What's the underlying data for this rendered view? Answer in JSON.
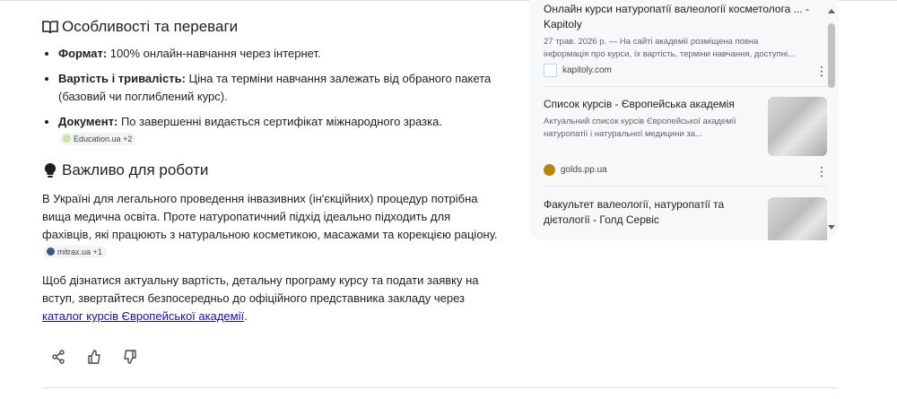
{
  "main": {
    "section1_title": "Особливості та переваги",
    "features": [
      {
        "label": "Формат:",
        "text": " 100% онлайн-навчання через інтернет."
      },
      {
        "label": "Вартість і тривалість:",
        "text": " Ціна та терміни навчання залежать від обраного пакета (базовий чи поглиблений курс)."
      },
      {
        "label": "Документ:",
        "text": " По завершенні видається сертифікат міжнародного зразка."
      }
    ],
    "chip1": {
      "label": "Education.ua",
      "count": "+2"
    },
    "section2_title": "Важливо для роботи",
    "para1": "В Україні для легального проведення інвазивних (ін'єкційних) процедур потрібна вища медична освіта. Проте натуропатичний підхід ідеально підходить для фахівців, які працюють з натуральною косметикою, масажами та корекцією раціону.",
    "chip2": {
      "label": "mitrax.ua",
      "count": "+1"
    },
    "para2": "Щоб дізнатися актуальну вартість, детальну програму курсу та подати заявку на вступ, звертайтеся безпосередньо до офіційного представника закладу через ",
    "para2_link": "каталог курсів Європейської академії",
    "para2_end": "."
  },
  "sources": [
    {
      "title": "Онлайн курси натуропатії валеології косметолога ... - Kapitoly",
      "snippet": "27 трав. 2026 р. — На сайті академії розміщена повна інформація про курси, їх вартість, терміни навчання, доступні...",
      "site": "kapitoly.com"
    },
    {
      "title": "Список курсів - Європейська академія",
      "snippet": "Актуальний список курсів Європейської академії натуропатії і натуральної медицини за...",
      "site": "golds.pp.ua"
    },
    {
      "title": "Факультет валеології, натуропатії та дієтології - Голд Сервіс",
      "snippet": "",
      "site": ""
    }
  ],
  "colors": {
    "link": "#1a0dab",
    "text": "#1f1f1f",
    "panel": "#f7f8fa"
  }
}
